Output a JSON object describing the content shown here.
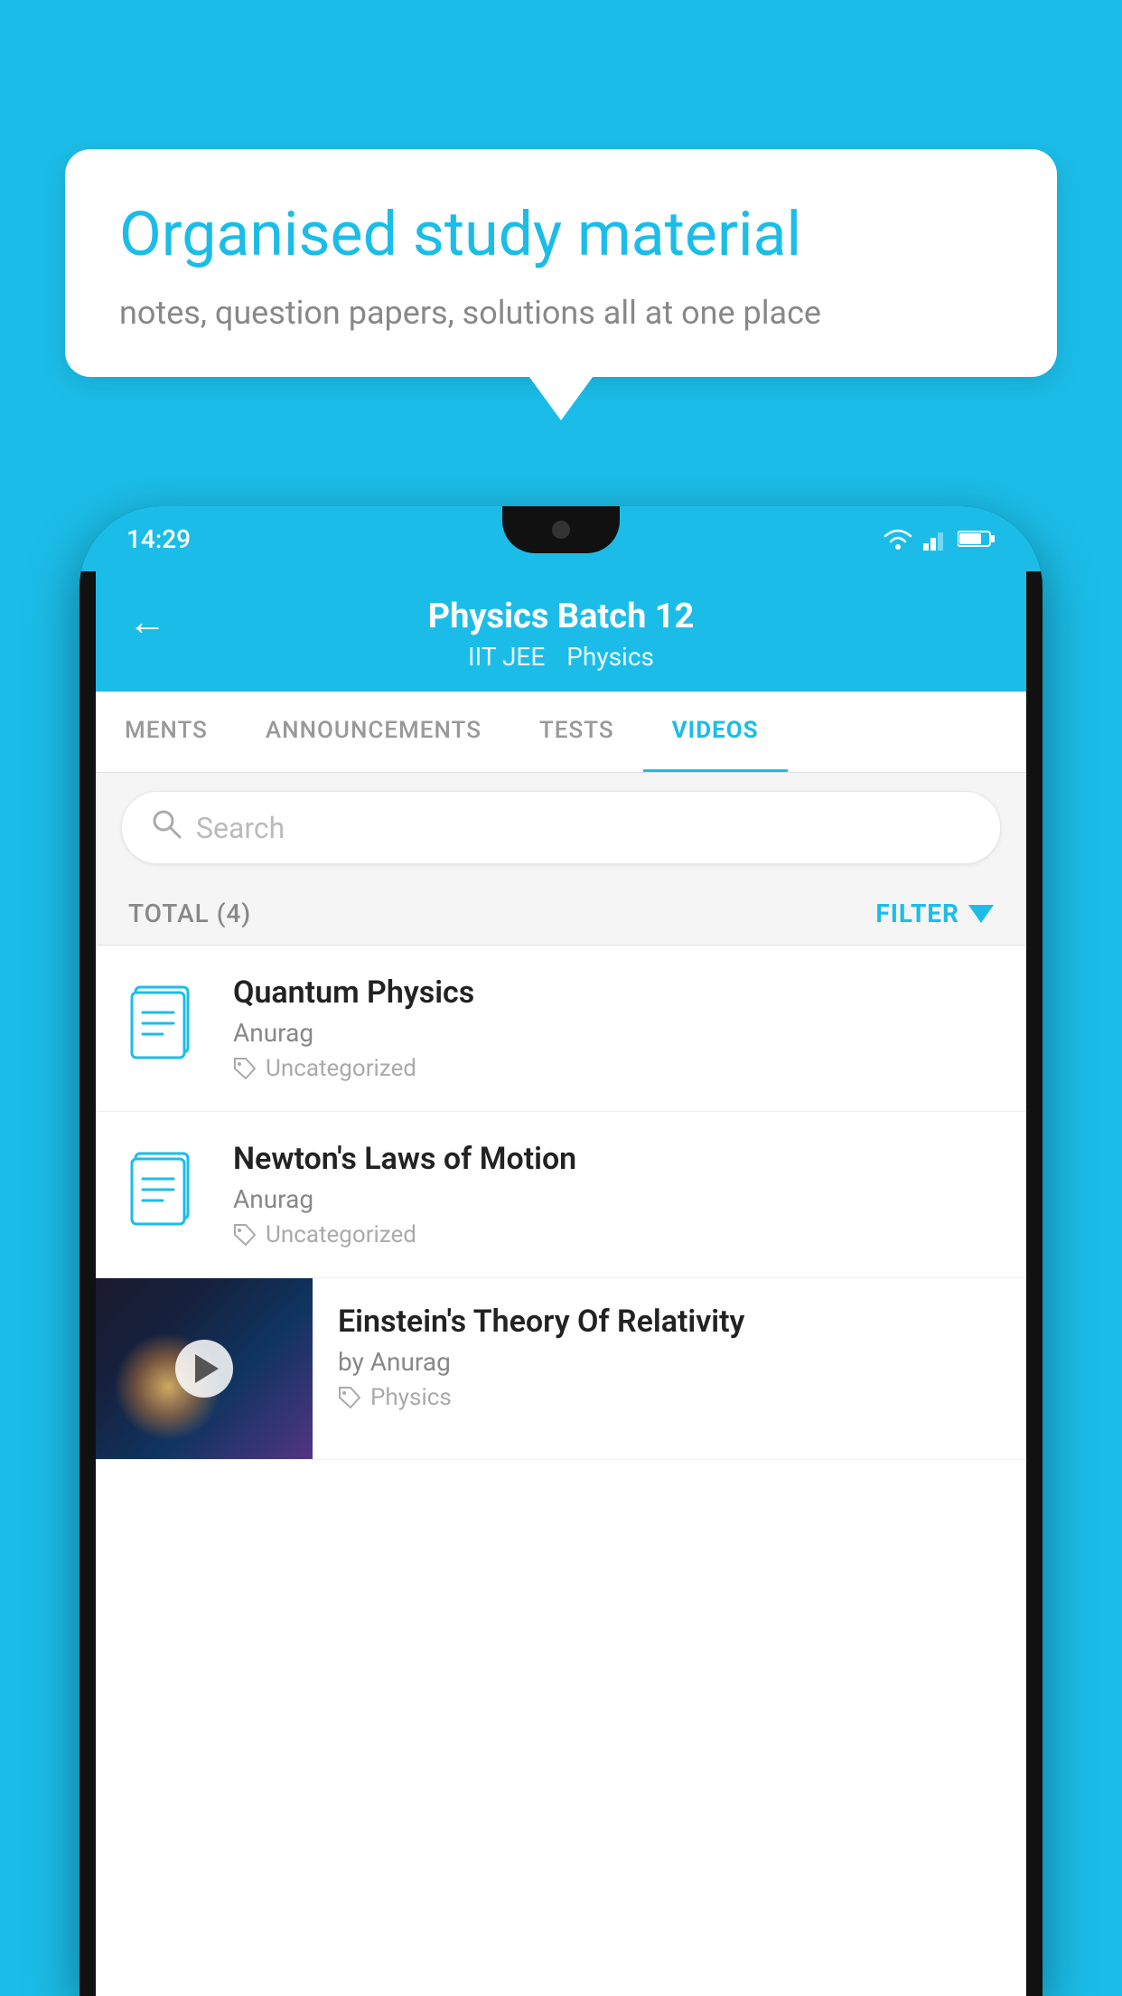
{
  "background_color": "#1BBDE8",
  "bubble": {
    "title": "Organised study material",
    "subtitle": "notes, question papers, solutions all at one place"
  },
  "status_bar": {
    "time": "14:29"
  },
  "header": {
    "title": "Physics Batch 12",
    "subtitle_left": "IIT JEE",
    "subtitle_right": "Physics",
    "back_label": "←"
  },
  "tabs": [
    {
      "label": "MENTS",
      "active": false
    },
    {
      "label": "ANNOUNCEMENTS",
      "active": false
    },
    {
      "label": "TESTS",
      "active": false
    },
    {
      "label": "VIDEOS",
      "active": true
    }
  ],
  "search": {
    "placeholder": "Search"
  },
  "filter_row": {
    "total_label": "TOTAL (4)",
    "filter_label": "FILTER"
  },
  "videos": [
    {
      "id": 1,
      "title": "Quantum Physics",
      "author": "Anurag",
      "tag": "Uncategorized",
      "has_thumb": false
    },
    {
      "id": 2,
      "title": "Newton's Laws of Motion",
      "author": "Anurag",
      "tag": "Uncategorized",
      "has_thumb": false
    },
    {
      "id": 3,
      "title": "Einstein's Theory Of Relativity",
      "author": "by Anurag",
      "tag": "Physics",
      "has_thumb": true
    }
  ]
}
